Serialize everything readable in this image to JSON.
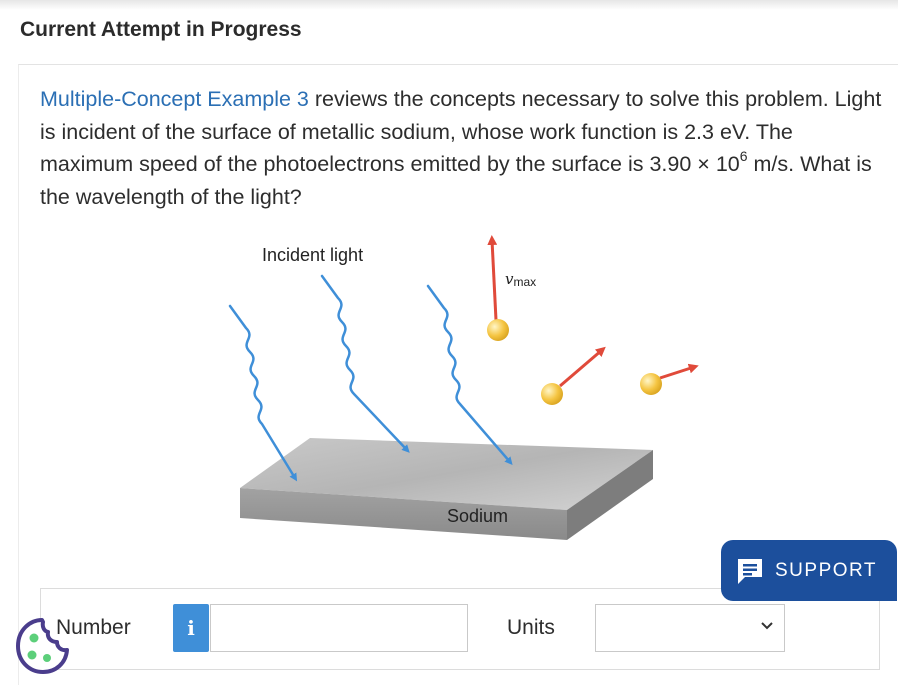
{
  "header": {
    "title": "Current Attempt in Progress"
  },
  "question": {
    "link_text": "Multiple-Concept Example 3",
    "text_1": " reviews the concepts necessary to solve this problem. Light is incident of the surface of metallic sodium, whose work function is 2.3 eV. The maximum speed of the photoelectrons emitted by the surface is 3.90 × 10",
    "exponent": "6",
    "text_2": " m/s. What is the wavelength of the light?"
  },
  "figure": {
    "incident_label": "Incident light",
    "vmax_symbol": "v",
    "vmax_subscript": "max",
    "surface_label": "Sodium"
  },
  "answer": {
    "number_label": "Number",
    "info_icon": "i",
    "number_value": "",
    "units_label": "Units",
    "units_value": ""
  },
  "support": {
    "label": "SUPPORT",
    "icon": "chat-icon"
  },
  "chat_widget": {
    "icon": "cookie-icon"
  },
  "colors": {
    "link": "#2b6fb4",
    "info_button": "#3f8fd8",
    "support_button": "#1c4f9c",
    "light_ray": "#3f8fd8",
    "velocity_arrow": "#e04a3a",
    "electron": "#f5c542"
  }
}
